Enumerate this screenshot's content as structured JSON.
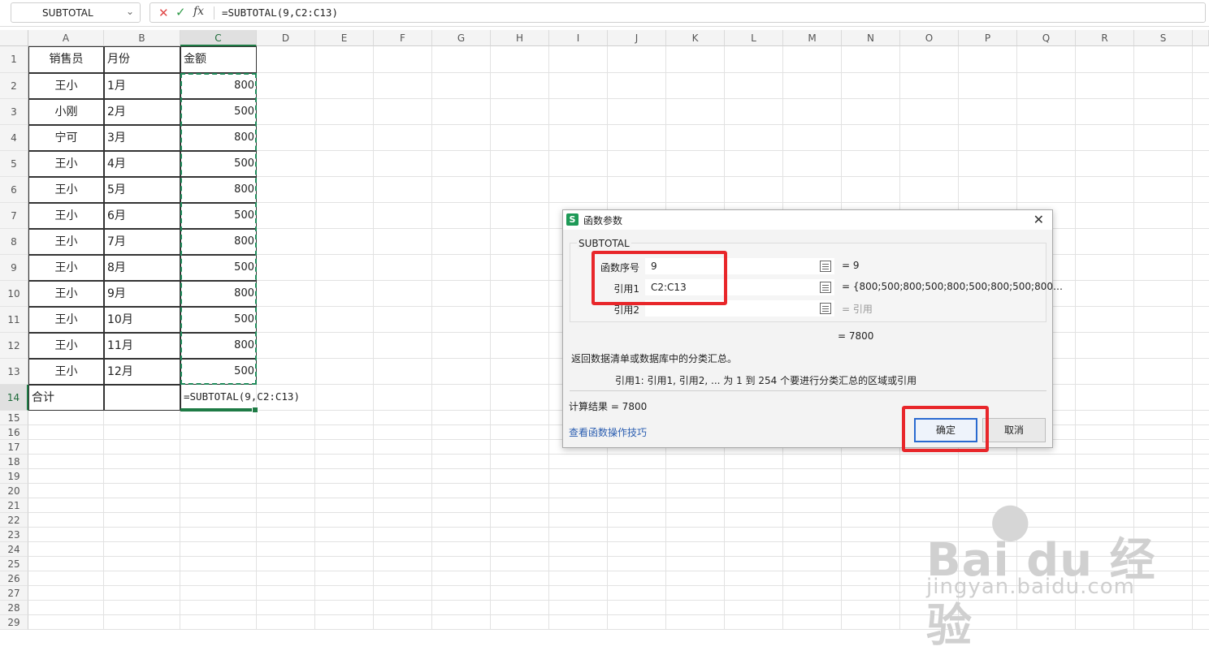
{
  "formula_bar": {
    "name_box": "SUBTOTAL",
    "formula": "=SUBTOTAL(9,C2:C13)"
  },
  "columns": [
    "A",
    "B",
    "C",
    "D",
    "E",
    "F",
    "G",
    "H",
    "I",
    "J",
    "K",
    "L",
    "M",
    "N",
    "O",
    "P",
    "Q",
    "R",
    "S"
  ],
  "active_column": "C",
  "active_row": 14,
  "rows": [
    "1",
    "2",
    "3",
    "4",
    "5",
    "6",
    "7",
    "8",
    "9",
    "10",
    "11",
    "12",
    "13",
    "14",
    "15",
    "16",
    "17",
    "18",
    "19",
    "20",
    "21",
    "22",
    "23",
    "24",
    "25",
    "26",
    "27",
    "28",
    "29"
  ],
  "table": {
    "headers": [
      "销售员",
      "月份",
      "金额"
    ],
    "body": [
      [
        "王小",
        "1月",
        "800"
      ],
      [
        "小刚",
        "2月",
        "500"
      ],
      [
        "宁可",
        "3月",
        "800"
      ],
      [
        "王小",
        "4月",
        "500"
      ],
      [
        "王小",
        "5月",
        "800"
      ],
      [
        "王小",
        "6月",
        "500"
      ],
      [
        "王小",
        "7月",
        "800"
      ],
      [
        "王小",
        "8月",
        "500"
      ],
      [
        "王小",
        "9月",
        "800"
      ],
      [
        "王小",
        "10月",
        "500"
      ],
      [
        "王小",
        "11月",
        "800"
      ],
      [
        "王小",
        "12月",
        "500"
      ]
    ],
    "total_row": [
      "合计",
      "",
      "=SUBTOTAL(9,C2:C13)"
    ]
  },
  "dialog": {
    "app_icon": "S",
    "title": "函数参数",
    "function_name": "SUBTOTAL",
    "args": [
      {
        "label": "函数序号",
        "value": "9",
        "result": "= 9"
      },
      {
        "label": "引用1",
        "value": "C2:C13",
        "result": "= {800;500;800;500;800;500;800;500;800…"
      },
      {
        "label": "引用2",
        "value": "",
        "result": "= 引用"
      }
    ],
    "total": "=  7800",
    "description": "返回数据清单或数据库中的分类汇总。",
    "arg_description": "引用1:   引用1, 引用2, ... 为 1 到 254 个要进行分类汇总的区域或引用",
    "calc_result": "计算结果  =  7800",
    "help_link": "查看函数操作技巧",
    "ok_label": "确定",
    "cancel_label": "取消"
  },
  "watermark": {
    "main": "Bai du 经验",
    "sub": "jingyan.baidu.com"
  },
  "colors": {
    "selection_green": "#1e7b45",
    "highlight_red": "#e8262a",
    "ok_border_blue": "#2a6ad0",
    "link_blue": "#2a5db0"
  }
}
